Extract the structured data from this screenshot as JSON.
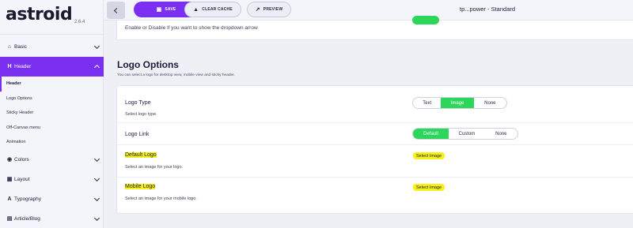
{
  "brand": {
    "logo": "astroid",
    "version": "2.6.4"
  },
  "sidebar": {
    "items": [
      {
        "label": "Basic",
        "icon": "home-icon"
      },
      {
        "label": "Header",
        "icon": "header-icon",
        "active": true,
        "sub": [
          "Header",
          "Logo Options",
          "Sticky Header",
          "Off-Canvas menu",
          "Animation"
        ]
      },
      {
        "label": "Colors",
        "icon": "palette-icon"
      },
      {
        "label": "Layout",
        "icon": "layout-icon"
      },
      {
        "label": "Typography",
        "icon": "typography-icon"
      },
      {
        "label": "Article/Blog",
        "icon": "article-icon"
      }
    ]
  },
  "toolbar": {
    "save_label": "SAVE",
    "clear_cache_label": "CLEAR CACHE",
    "preview_label": "PREVIEW",
    "template_title": "tp...power - Standard"
  },
  "prev_field": {
    "description": "Enable or Disable if you want to show the dropdown arrow"
  },
  "section": {
    "title": "Logo Options",
    "description": "You can select a logo for desktop view, mobile view and sticky header."
  },
  "fields": {
    "logo_type": {
      "label": "Logo Type",
      "hint": "Select logo type.",
      "options": [
        "Text",
        "Image",
        "None"
      ],
      "selected": "Image"
    },
    "logo_link": {
      "label": "Logo Link",
      "options": [
        "Default",
        "Custom",
        "None"
      ],
      "selected": "Default"
    },
    "default_logo": {
      "label": "Default Logo",
      "hint": "Select an image for your logo.",
      "button": "Select Image"
    },
    "mobile_logo": {
      "label": "Mobile Logo",
      "hint": "Select an image for your mobile logo.",
      "button": "Select Image"
    }
  },
  "colors": {
    "accent": "#7b2ff0",
    "toggle_on": "#2bd65a",
    "highlight": "#f5ef1a"
  }
}
